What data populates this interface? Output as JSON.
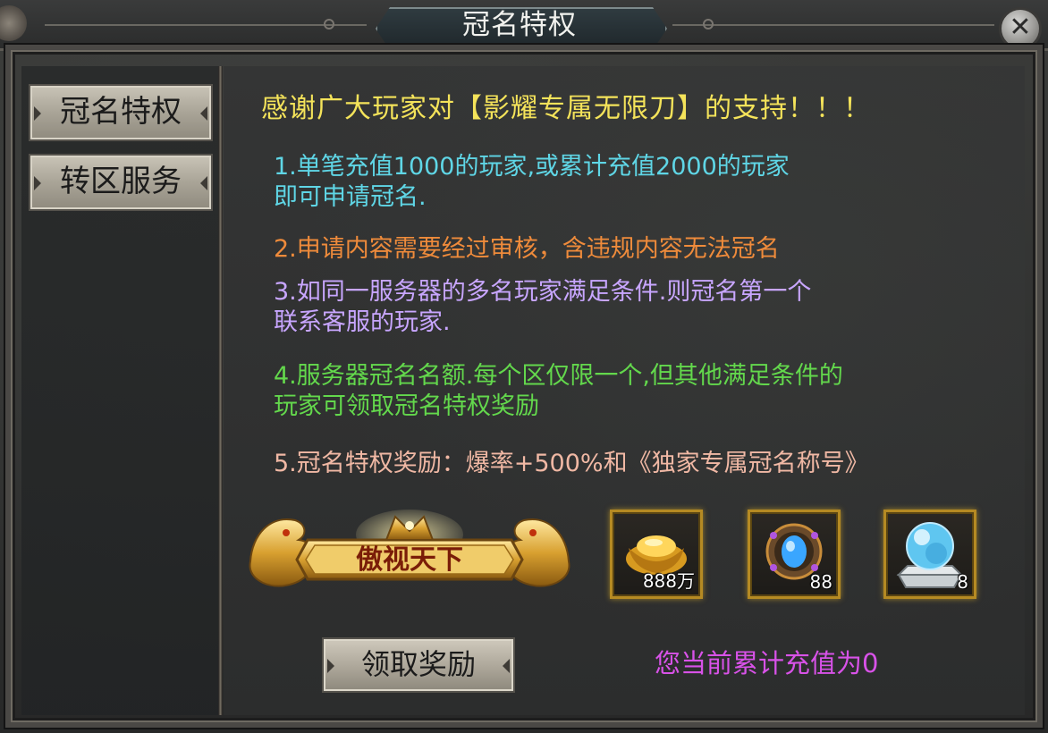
{
  "window": {
    "title": "冠名特权",
    "close_label": "✕"
  },
  "sidebar": {
    "items": [
      {
        "label": "冠名特权",
        "active": true
      },
      {
        "label": "转区服务",
        "active": false
      }
    ]
  },
  "main": {
    "headline": "感谢广大玩家对【影耀专属无限刀】的支持！！！",
    "rules": [
      {
        "line1": "1.单笔充值1000的玩家,或累计充值2000的玩家",
        "line2": "即可申请冠名.",
        "color": "#5fd6e6"
      },
      {
        "line1": "2.申请内容需要经过审核，含违规内容无法冠名",
        "color": "#ef8b3b"
      },
      {
        "line1": "3.如同一服务器的多名玩家满足条件.则冠名第一个",
        "line2": "联系客服的玩家.",
        "color": "#c8a6ff"
      },
      {
        "line1": "4.服务器冠名名额.每个区仅限一个,但其他满足条件的",
        "line2": "玩家可领取冠名特权奖励",
        "color": "#63d84c"
      },
      {
        "line1": "5.冠名特权奖励：爆率+500%和《独家专属冠名称号》",
        "color": "#f0b8a4"
      }
    ],
    "title_badge_text": "傲视天下",
    "rewards": [
      {
        "icon": "gold-ingot-icon",
        "count": "888万"
      },
      {
        "icon": "blue-gem-amulet-icon",
        "count": "88"
      },
      {
        "icon": "crystal-orb-icon",
        "count": "8"
      }
    ],
    "claim_button": "领取奖励",
    "recharge_status": "您当前累计充值为0"
  },
  "colors": {
    "headline": "#f4e35a",
    "status": "#d852e8",
    "item_border": "#b58a23"
  }
}
